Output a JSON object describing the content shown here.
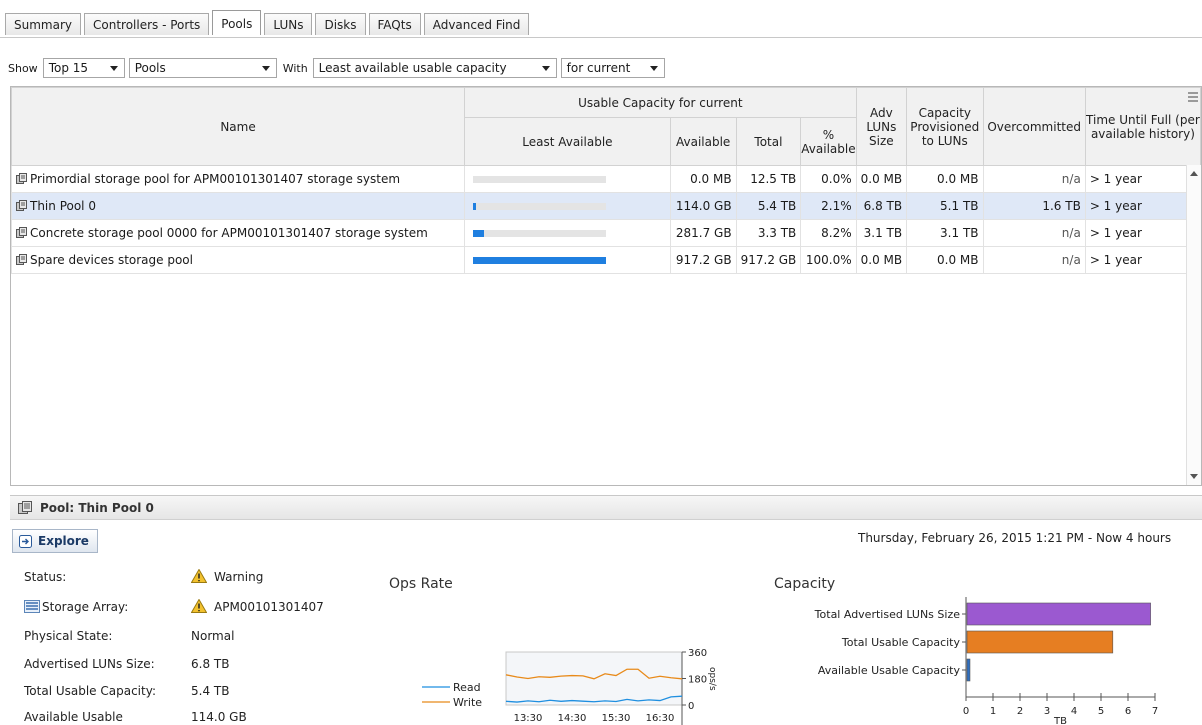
{
  "tabs": [
    "Summary",
    "Controllers - Ports",
    "Pools",
    "LUNs",
    "Disks",
    "FAQts",
    "Advanced Find"
  ],
  "active_tab": "Pools",
  "filters": {
    "show_label": "Show",
    "top": "Top 15",
    "object": "Pools",
    "with_label": "With",
    "metric": "Least available usable capacity",
    "period": "for current"
  },
  "table": {
    "group_header": "Usable Capacity for current",
    "headers": {
      "name": "Name",
      "least_available": "Least Available",
      "available": "Available",
      "total": "Total",
      "pct_available": "% Available",
      "adv_luns_size": "Adv LUNs Size",
      "capacity_provisioned": "Capacity Provisioned to LUNs",
      "overcommitted": "Overcommitted",
      "time_until_full": "Time Until Full (per available history)"
    },
    "rows": [
      {
        "name": "Primordial storage pool for APM00101301407 storage system",
        "least_available_fraction": 0.0,
        "available": "0.0 MB",
        "total": "12.5 TB",
        "pct": "0.0%",
        "adv": "0.0 MB",
        "prov": "0.0 MB",
        "over": "n/a",
        "time": "> 1 year",
        "selected": false
      },
      {
        "name": "Thin Pool 0",
        "least_available_fraction": 0.021,
        "available": "114.0 GB",
        "total": "5.4 TB",
        "pct": "2.1%",
        "adv": "6.8 TB",
        "prov": "5.1 TB",
        "over": "1.6 TB",
        "time": "> 1 year",
        "selected": true
      },
      {
        "name": "Concrete storage pool 0000 for APM00101301407 storage system",
        "least_available_fraction": 0.082,
        "available": "281.7 GB",
        "total": "3.3 TB",
        "pct": "8.2%",
        "adv": "3.1 TB",
        "prov": "3.1 TB",
        "over": "n/a",
        "time": "> 1 year",
        "selected": false
      },
      {
        "name": "Spare devices storage pool",
        "least_available_fraction": 1.0,
        "available": "917.2 GB",
        "total": "917.2 GB",
        "pct": "100.0%",
        "adv": "0.0 MB",
        "prov": "0.0 MB",
        "over": "n/a",
        "time": "> 1 year",
        "selected": false
      }
    ]
  },
  "detail": {
    "title": "Pool: Thin Pool 0",
    "explore": "Explore",
    "date": "Thursday, February 26, 2015 1:21 PM - Now  4 hours",
    "status_label": "Status:",
    "status_value": "Warning",
    "array_label": "Storage Array:",
    "array_value": "APM00101301407",
    "physical_label": "Physical State:",
    "physical_value": "Normal",
    "adv_label": "Advertised LUNs Size:",
    "adv_value": "6.8 TB",
    "total_label": "Total Usable Capacity:",
    "total_value": "5.4 TB",
    "avail_label": "Available Usable",
    "avail_value": "114.0 GB"
  },
  "ops_chart": {
    "title": "Ops Rate",
    "y_unit": "ops/s",
    "y_ticks": [
      "360",
      "180",
      "0"
    ],
    "x_ticks": [
      "13:30",
      "14:30",
      "15:30",
      "16:30"
    ],
    "legend": [
      "Read",
      "Write"
    ],
    "colors": {
      "read": "#1f8fe0",
      "write": "#e88a1a"
    }
  },
  "chart_data": [
    {
      "type": "line",
      "title": "Ops Rate",
      "ylabel": "ops/s",
      "ylim": [
        0,
        360
      ],
      "x": [
        "13:00",
        "13:15",
        "13:30",
        "13:45",
        "14:00",
        "14:15",
        "14:30",
        "14:45",
        "15:00",
        "15:15",
        "15:30",
        "15:45",
        "16:00",
        "16:15",
        "16:30",
        "16:45",
        "17:00"
      ],
      "series": [
        {
          "name": "Write",
          "values": [
            205,
            190,
            180,
            192,
            188,
            196,
            200,
            198,
            178,
            212,
            200,
            243,
            243,
            182,
            195,
            185,
            178
          ]
        },
        {
          "name": "Read",
          "values": [
            25,
            20,
            28,
            22,
            32,
            25,
            30,
            26,
            22,
            28,
            24,
            38,
            28,
            35,
            30,
            55,
            60
          ]
        }
      ]
    },
    {
      "type": "bar",
      "title": "Capacity",
      "xlabel": "TB",
      "xlim": [
        0,
        7
      ],
      "x_ticks": [
        "0",
        "1",
        "2",
        "3",
        "4",
        "5",
        "6",
        "7"
      ],
      "categories": [
        "Total Advertised LUNs Size",
        "Total Usable Capacity",
        "Available Usable Capacity"
      ],
      "values": [
        6.8,
        5.4,
        0.11
      ],
      "colors": [
        "#9b59d0",
        "#e67e22",
        "#2e6fc0"
      ]
    }
  ]
}
